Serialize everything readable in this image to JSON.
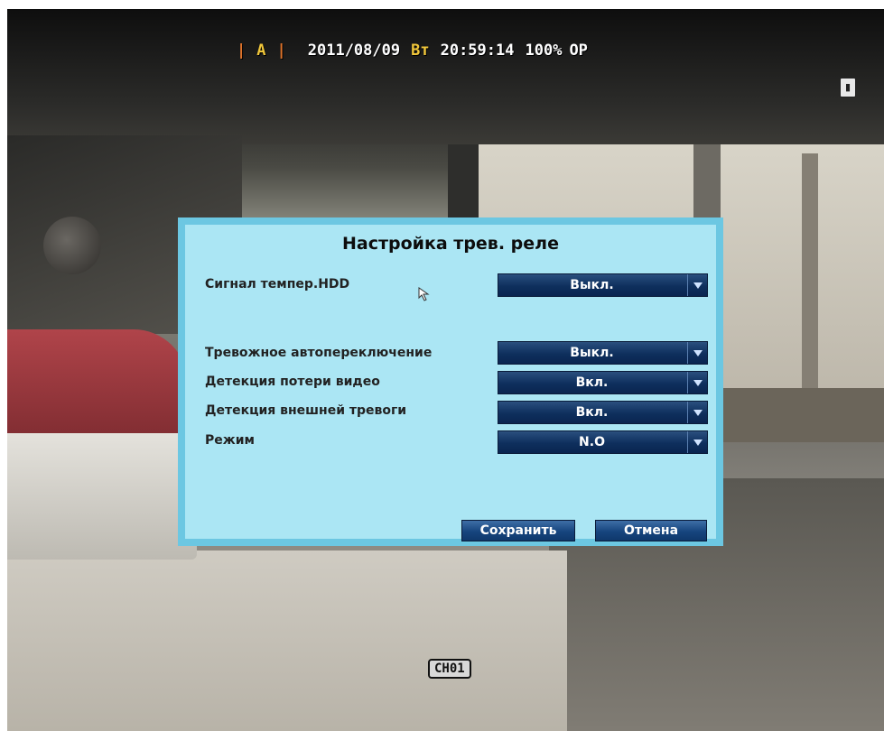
{
  "osd": {
    "rec_mode": "A",
    "date": "2011/08/09",
    "weekday": "Вт",
    "time": "20:59:14",
    "hdd_usage": "100%",
    "hdd_mode": "OP",
    "channel": "CH01",
    "icons": [
      "hdd-icon"
    ]
  },
  "dialog": {
    "title": "Настройка трев. реле",
    "rows": [
      {
        "label": "Сигнал темпер.HDD",
        "value": "Выкл."
      },
      {
        "label": "Тревожное автопереключение",
        "value": "Выкл."
      },
      {
        "label": "Детекция потери видео",
        "value": "Вкл."
      },
      {
        "label": "Детекция внешней тревоги",
        "value": "Вкл."
      },
      {
        "label": "Режим",
        "value": "N.O"
      }
    ],
    "save_label": "Сохранить",
    "cancel_label": "Отмена"
  },
  "colors": {
    "dialog_bg": "#abe6f4",
    "dialog_border": "#6cc7e2",
    "control_bg": "#0e2f5d",
    "osd_accent": "#f0c63a"
  }
}
